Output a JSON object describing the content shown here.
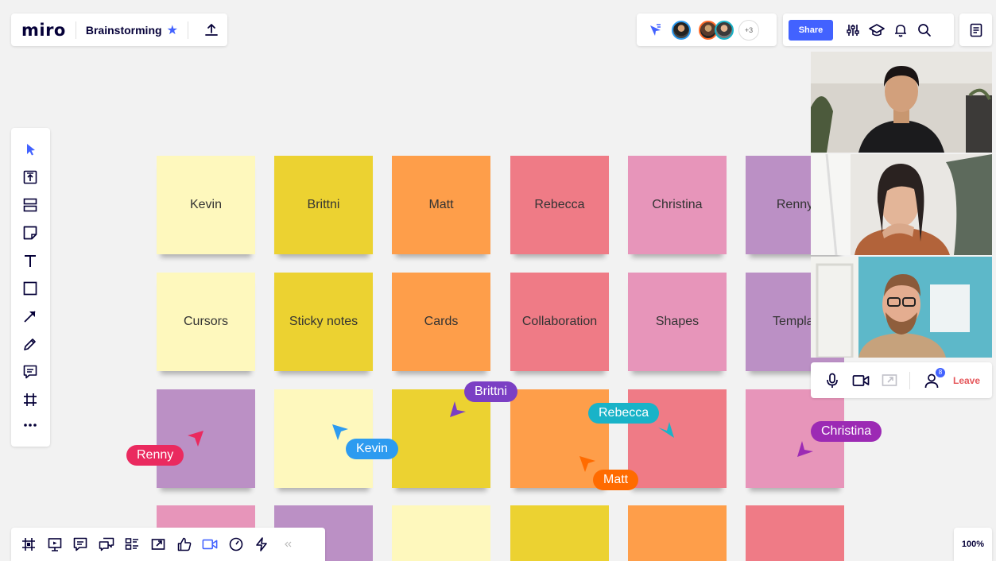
{
  "header": {
    "logo": "miro",
    "board_title": "Brainstorming",
    "collaborators_more": "+3",
    "share_label": "Share"
  },
  "stickies": {
    "row1": [
      "Kevin",
      "Brittni",
      "Matt",
      "Rebecca",
      "Christina",
      "Renny"
    ],
    "row2": [
      "Cursors",
      "Sticky notes",
      "Cards",
      "Collaboration",
      "Shapes",
      "Templat"
    ]
  },
  "cursors": {
    "renny": "Renny",
    "kevin": "Kevin",
    "brittni": "Brittni",
    "rebecca": "Rebecca",
    "matt": "Matt",
    "christina": "Christina"
  },
  "cursor_colors": {
    "renny": "#ea2a5f",
    "kevin": "#2d9bf0",
    "brittni": "#7b3fc4",
    "rebecca": "#19b3c8",
    "matt": "#ff6b00",
    "christina": "#9c2ab4"
  },
  "video_controls": {
    "participants_count": "8",
    "leave_label": "Leave"
  },
  "zoom": "100%",
  "colors": {
    "accent": "#4262ff",
    "light_yellow": "#fef8bd",
    "yellow": "#ecd231",
    "orange": "#fe9e4a",
    "red": "#ef7b86",
    "pink": "#e795ba",
    "purple": "#bb90c5"
  }
}
